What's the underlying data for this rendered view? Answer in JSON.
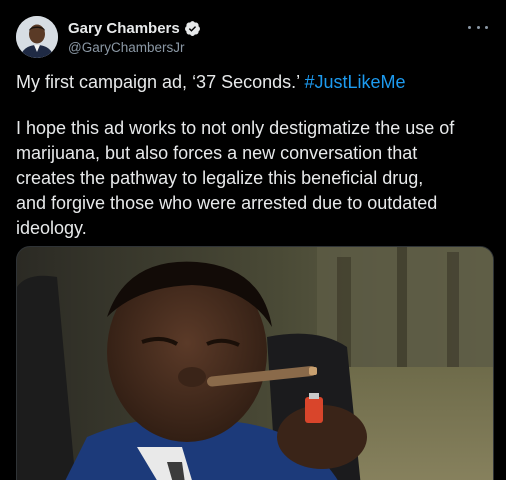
{
  "tweet": {
    "author": {
      "display_name": "Gary Chambers",
      "handle": "@GaryChambersJr",
      "verified_icon": "verified-badge-icon",
      "avatar_icon": "profile-photo"
    },
    "more_icon": "more-options-icon",
    "text": {
      "line1_prefix": "My first campaign ad, ‘37 Seconds.’ ",
      "hashtag": "#JustLikeMe",
      "para2_lines": [
        "I hope this ad works to not only destigmatize the use of",
        "marijuana, but also forces a new conversation that",
        "creates the pathway to legalize this beneficial drug,",
        "and forgive those who were arrested due to outdated",
        "ideology."
      ]
    },
    "media": {
      "description_icon": "video-thumbnail"
    }
  },
  "colors": {
    "background": "#000000",
    "text": "#e7e9ea",
    "secondary_text": "#8b98a5",
    "link": "#1d9bf0",
    "verified": "#1d9bf0"
  }
}
